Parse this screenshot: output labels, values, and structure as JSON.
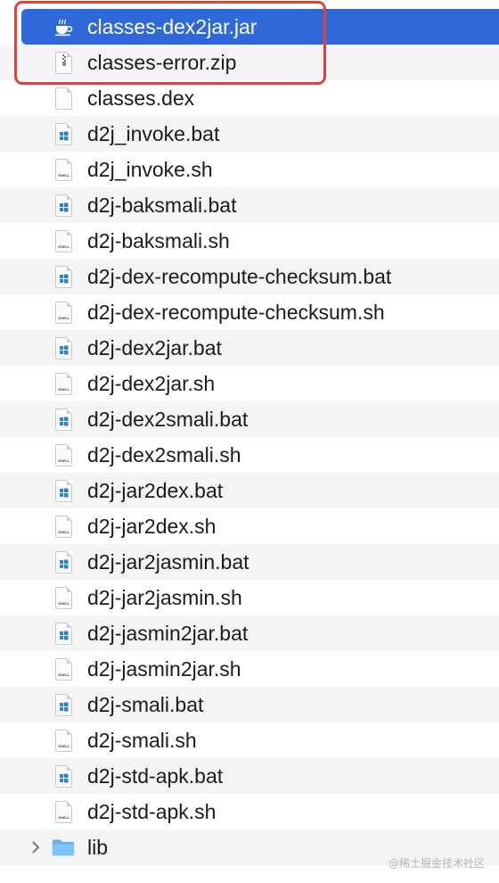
{
  "files": [
    {
      "name": "classes-dex2jar.jar",
      "icon": "java-cup-icon",
      "selected": true
    },
    {
      "name": "classes-error.zip",
      "icon": "zip-archive-icon"
    },
    {
      "name": "classes.dex",
      "icon": "blank-document-icon"
    },
    {
      "name": "d2j_invoke.bat",
      "icon": "windows-batch-icon"
    },
    {
      "name": "d2j_invoke.sh",
      "icon": "shell-script-icon"
    },
    {
      "name": "d2j-baksmali.bat",
      "icon": "windows-batch-icon"
    },
    {
      "name": "d2j-baksmali.sh",
      "icon": "shell-script-icon"
    },
    {
      "name": "d2j-dex-recompute-checksum.bat",
      "icon": "windows-batch-icon"
    },
    {
      "name": "d2j-dex-recompute-checksum.sh",
      "icon": "shell-script-icon"
    },
    {
      "name": "d2j-dex2jar.bat",
      "icon": "windows-batch-icon"
    },
    {
      "name": "d2j-dex2jar.sh",
      "icon": "shell-script-icon"
    },
    {
      "name": "d2j-dex2smali.bat",
      "icon": "windows-batch-icon"
    },
    {
      "name": "d2j-dex2smali.sh",
      "icon": "shell-script-icon"
    },
    {
      "name": "d2j-jar2dex.bat",
      "icon": "windows-batch-icon"
    },
    {
      "name": "d2j-jar2dex.sh",
      "icon": "shell-script-icon"
    },
    {
      "name": "d2j-jar2jasmin.bat",
      "icon": "windows-batch-icon"
    },
    {
      "name": "d2j-jar2jasmin.sh",
      "icon": "shell-script-icon"
    },
    {
      "name": "d2j-jasmin2jar.bat",
      "icon": "windows-batch-icon"
    },
    {
      "name": "d2j-jasmin2jar.sh",
      "icon": "shell-script-icon"
    },
    {
      "name": "d2j-smali.bat",
      "icon": "windows-batch-icon"
    },
    {
      "name": "d2j-smali.sh",
      "icon": "shell-script-icon"
    },
    {
      "name": "d2j-std-apk.bat",
      "icon": "windows-batch-icon"
    },
    {
      "name": "d2j-std-apk.sh",
      "icon": "shell-script-icon"
    },
    {
      "name": "lib",
      "icon": "folder-icon",
      "folder": true
    }
  ],
  "shell_icon_label": "SHELL",
  "watermark": "@稀土掘金技术社区",
  "colors": {
    "selection": "#2f68d8",
    "highlight_border": "#e2403c",
    "stripe": "#f4f4f5",
    "windows_blue": "#2f7fd6",
    "folder_blue": "#5fb1ef"
  }
}
